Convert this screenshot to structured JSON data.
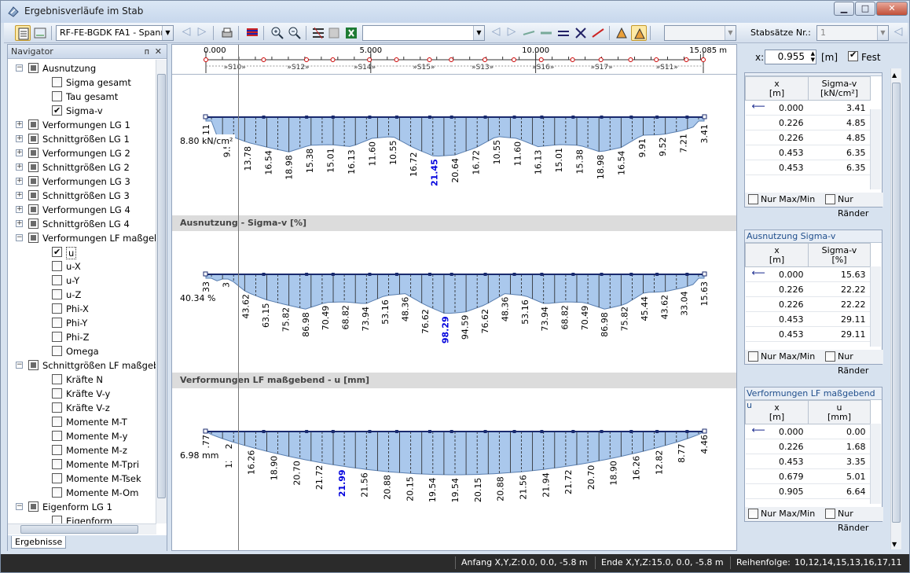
{
  "window": {
    "title": "Ergebnisverläufe im Stab",
    "btn_minimize": "▁",
    "btn_maximize": "□",
    "btn_close": "✕"
  },
  "toolbar": {
    "case_combo": "RF-FE-BGDK FA1 - Spann",
    "empty_combo": "",
    "empty_combo2": "",
    "stabsaetze_label": "Stabsätze Nr.:",
    "stabsaetze_value": "1"
  },
  "navigator": {
    "title": "Navigator",
    "pin": "ᴨ",
    "close": "✕",
    "items": [
      {
        "label": "Ausnutzung",
        "level": 0,
        "state": "part",
        "expanded": true
      },
      {
        "label": "Sigma gesamt",
        "level": 1,
        "state": "off"
      },
      {
        "label": "Tau gesamt",
        "level": 1,
        "state": "off"
      },
      {
        "label": "Sigma-v",
        "level": 1,
        "state": "on"
      },
      {
        "label": "Verformungen LG 1",
        "level": 0,
        "state": "part",
        "expanded": false
      },
      {
        "label": "Schnittgrößen LG 1",
        "level": 0,
        "state": "part",
        "expanded": false
      },
      {
        "label": "Verformungen LG 2",
        "level": 0,
        "state": "part",
        "expanded": false
      },
      {
        "label": "Schnittgrößen LG 2",
        "level": 0,
        "state": "part",
        "expanded": false
      },
      {
        "label": "Verformungen LG 3",
        "level": 0,
        "state": "part",
        "expanded": false
      },
      {
        "label": "Schnittgrößen LG 3",
        "level": 0,
        "state": "part",
        "expanded": false
      },
      {
        "label": "Verformungen LG 4",
        "level": 0,
        "state": "part",
        "expanded": false
      },
      {
        "label": "Schnittgrößen LG 4",
        "level": 0,
        "state": "part",
        "expanded": false
      },
      {
        "label": "Verformungen LF maßgeb",
        "level": 0,
        "state": "part",
        "expanded": true
      },
      {
        "label": "u",
        "level": 1,
        "state": "on"
      },
      {
        "label": "u-X",
        "level": 1,
        "state": "off"
      },
      {
        "label": "u-Y",
        "level": 1,
        "state": "off"
      },
      {
        "label": "u-Z",
        "level": 1,
        "state": "off"
      },
      {
        "label": "Phi-X",
        "level": 1,
        "state": "off"
      },
      {
        "label": "Phi-Y",
        "level": 1,
        "state": "off"
      },
      {
        "label": "Phi-Z",
        "level": 1,
        "state": "off"
      },
      {
        "label": "Omega",
        "level": 1,
        "state": "off"
      },
      {
        "label": "Schnittgrößen LF maßgebe",
        "level": 0,
        "state": "part",
        "expanded": true
      },
      {
        "label": "Kräfte N",
        "level": 1,
        "state": "off"
      },
      {
        "label": "Kräfte V-y",
        "level": 1,
        "state": "off"
      },
      {
        "label": "Kräfte V-z",
        "level": 1,
        "state": "off"
      },
      {
        "label": "Momente M-T",
        "level": 1,
        "state": "off"
      },
      {
        "label": "Momente M-y",
        "level": 1,
        "state": "off"
      },
      {
        "label": "Momente M-z",
        "level": 1,
        "state": "off"
      },
      {
        "label": "Momente M-Tpri",
        "level": 1,
        "state": "off"
      },
      {
        "label": "Momente M-Tsek",
        "level": 1,
        "state": "off"
      },
      {
        "label": "Momente M-Om",
        "level": 1,
        "state": "off"
      },
      {
        "label": "Eigenform LG 1",
        "level": 0,
        "state": "part",
        "expanded": true
      },
      {
        "label": "Eigenform",
        "level": 1,
        "state": "off"
      }
    ],
    "tab": "Ergebnisse"
  },
  "ruler": {
    "ticks": [
      "0.000",
      "5.000",
      "10.000",
      "15.085 m"
    ],
    "tick_values": [
      0,
      5,
      10,
      15.085
    ],
    "max": 15.085,
    "segments": [
      "»S10»",
      "»S12»",
      "»S14»",
      "»S15»",
      "»S13»",
      "»S16»",
      "»S17»",
      "»S11»"
    ],
    "node_values": [
      0,
      1.75,
      3.05,
      3.85,
      4.96,
      5.78,
      6.78,
      7.44,
      8.46,
      9.34,
      10.17,
      11.12,
      11.98,
      12.88,
      13.66,
      14.57,
      15.085
    ]
  },
  "x_control": {
    "label": "x:",
    "value": "0.955",
    "unit": "[m]",
    "fest_label": "Fest"
  },
  "diagrams": [
    {
      "section_title": "",
      "current_label": "8.80 kN/cm²",
      "labels": [
        "11",
        "9.52",
        "13.78",
        "16.54",
        "18.98",
        "15.38",
        "15.01",
        "16.13",
        "11.60",
        "10.55",
        "16.72",
        "21.45",
        "20.64",
        "16.72",
        "10.55",
        "11.60",
        "16.13",
        "15.01",
        "15.38",
        "18.98",
        "16.54",
        "9.91",
        "9.52",
        "7.21",
        "3.41"
      ],
      "max_label": "21.45",
      "max_sub": "20.64"
    },
    {
      "section_title": "Ausnutzung - Sigma-v [%]",
      "current_label": "40.34 %",
      "labels": [
        "33",
        "3",
        "43.62",
        "63.15",
        "75.82",
        "86.98",
        "70.49",
        "68.82",
        "73.94",
        "53.16",
        "48.36",
        "76.62",
        "98.29",
        "94.59",
        "76.62",
        "48.36",
        "53.16",
        "73.94",
        "68.82",
        "70.49",
        "86.98",
        "75.82",
        "45.44",
        "43.62",
        "33.04",
        "15.63"
      ],
      "max_label": "98.29",
      "max_sub": "94.59"
    },
    {
      "section_title": "Verformungen LF maßgebend - u [mm]",
      "current_label": "6.98 mm",
      "labels": [
        "8.77",
        "12.82",
        "16.26",
        "18.90",
        "20.70",
        "21.72",
        "21.99",
        "21.56",
        "20.88",
        "20.15",
        "19.54",
        "19.54",
        "20.15",
        "20.88",
        "21.56",
        "21.94",
        "21.72",
        "20.70",
        "18.90",
        "16.26",
        "12.82",
        "8.77",
        "4.46"
      ],
      "max_label": "21.99",
      "max_sub": "21.56"
    }
  ],
  "panels": [
    {
      "title": "Spannungen Sigma-v",
      "col1": "x",
      "col1_unit": "[m]",
      "col2": "Sigma-v",
      "col2_unit": "[kN/cm²]",
      "rows": [
        [
          "0.000",
          "3.41"
        ],
        [
          "0.226",
          "4.85"
        ],
        [
          "0.226",
          "4.85"
        ],
        [
          "0.453",
          "6.35"
        ],
        [
          "0.453",
          "6.35"
        ]
      ],
      "chk1": "Nur Max/Min",
      "chk2": "Nur Ränder"
    },
    {
      "title": "Ausnutzung Sigma-v",
      "col1": "x",
      "col1_unit": "[m]",
      "col2": "Sigma-v",
      "col2_unit": "[%]",
      "rows": [
        [
          "0.000",
          "15.63"
        ],
        [
          "0.226",
          "22.22"
        ],
        [
          "0.226",
          "22.22"
        ],
        [
          "0.453",
          "29.11"
        ],
        [
          "0.453",
          "29.11"
        ]
      ],
      "chk1": "Nur Max/Min",
      "chk2": "Nur Ränder"
    },
    {
      "title": "Verformungen LF maßgebend u",
      "col1": "x",
      "col1_unit": "[m]",
      "col2": "u",
      "col2_unit": "[mm]",
      "rows": [
        [
          "0.000",
          "0.00"
        ],
        [
          "0.226",
          "1.68"
        ],
        [
          "0.453",
          "3.35"
        ],
        [
          "0.679",
          "5.01"
        ],
        [
          "0.905",
          "6.64"
        ]
      ],
      "chk1": "Nur Max/Min",
      "chk2": "Nur Ränder"
    }
  ],
  "status": {
    "anfang_label": "Anfang X,Y,Z:",
    "anfang_value": "0.0, 0.0, -5.8 m",
    "ende_label": "Ende X,Y,Z:",
    "ende_value": "15.0, 0.0, -5.8 m",
    "reihe_label": "Reihenfolge:",
    "reihe_value": "10,12,14,15,13,16,17,11"
  },
  "colors": {
    "fill": "#aac8ec",
    "line": "#1a2a6e",
    "node": "#1a2a6e",
    "max": "#0000dd",
    "node_ruler": "#cc0000"
  }
}
